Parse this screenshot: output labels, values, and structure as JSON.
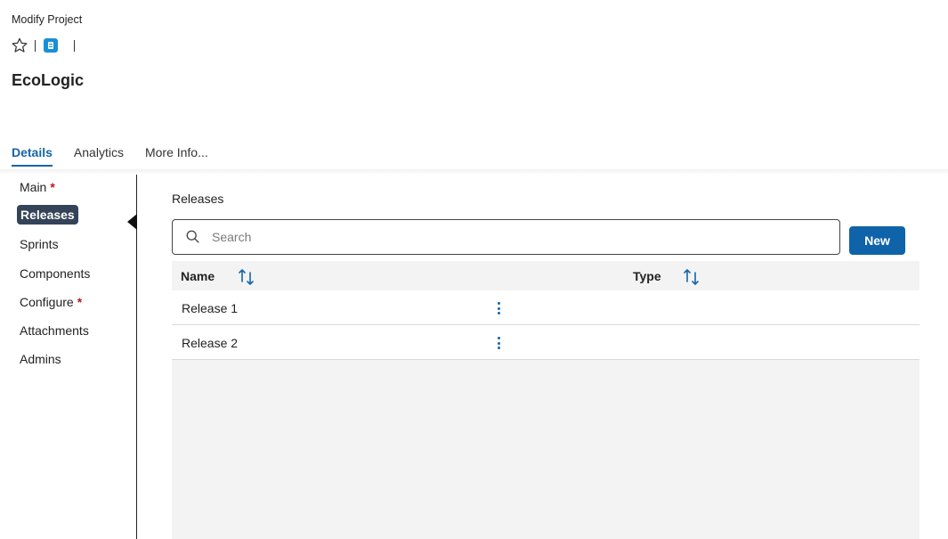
{
  "header": {
    "breadcrumb": "Modify Project",
    "title": "EcoLogic",
    "star_icon": "star-outline-icon",
    "page_icon": "document-icon"
  },
  "tabs": [
    {
      "label": "Details",
      "active": true
    },
    {
      "label": "Analytics",
      "active": false
    },
    {
      "label": "More Info...",
      "active": false
    }
  ],
  "sidebar": {
    "items": [
      {
        "label": "Main",
        "required": "*"
      },
      {
        "label": "Releases",
        "active": true
      },
      {
        "label": "Sprints"
      },
      {
        "label": "Components"
      },
      {
        "label": "Configure",
        "required": "*"
      },
      {
        "label": "Attachments"
      },
      {
        "label": "Admins"
      }
    ]
  },
  "main": {
    "section_title": "Releases",
    "search": {
      "placeholder": "Search",
      "value": ""
    },
    "new_button": "New",
    "table": {
      "columns": [
        "Name",
        "Type"
      ],
      "rows": [
        {
          "name": "Release 1",
          "type": ""
        },
        {
          "name": "Release 2",
          "type": ""
        }
      ]
    }
  },
  "colors": {
    "accent": "#1565a8",
    "button": "#0f63a8",
    "active_sidebar_bg": "#344357",
    "required": "#c0161d"
  }
}
